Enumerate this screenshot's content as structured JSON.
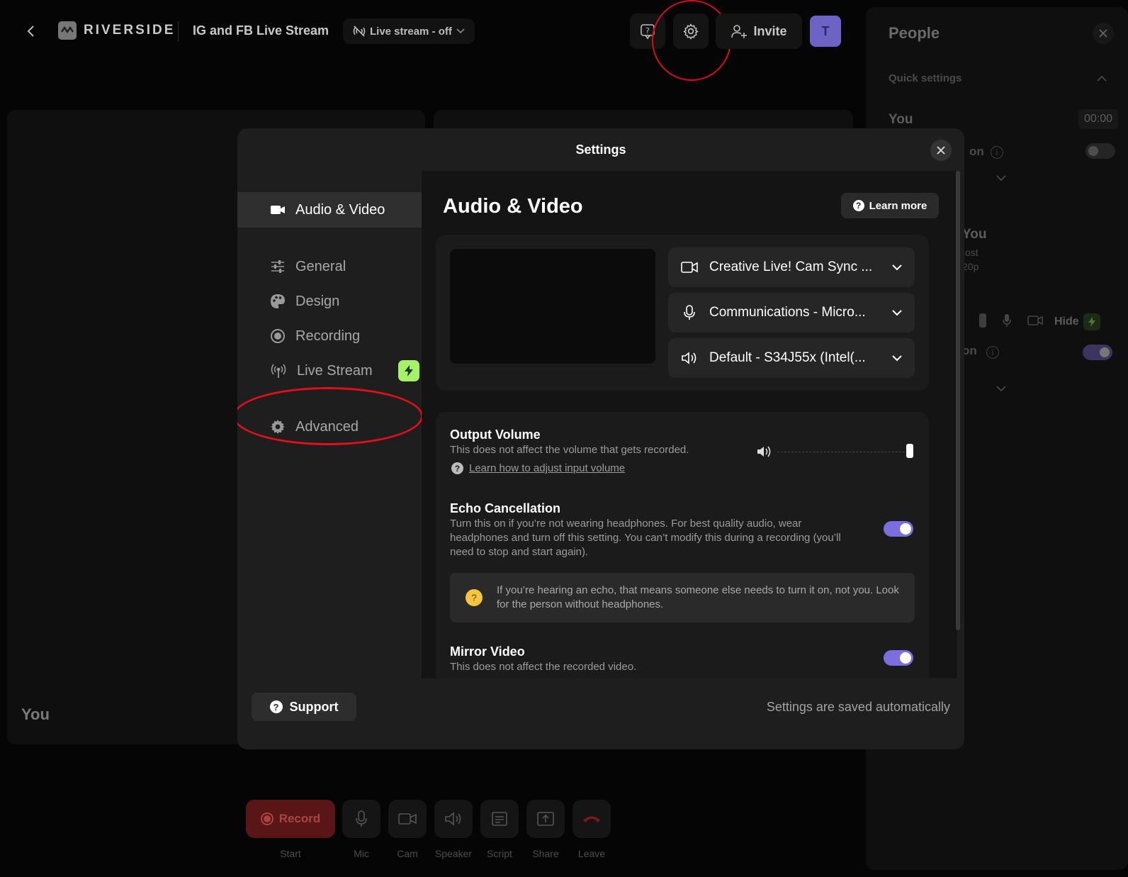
{
  "topbar": {
    "brand": "RIVERSIDE",
    "studio_title": "IG and FB Live Stream",
    "live_stream_status": "Live stream - off",
    "invite_label": "Invite",
    "avatar_initial": "T"
  },
  "stage": {
    "you_label": "You"
  },
  "people_panel": {
    "title": "People",
    "quick_settings": "Quick settings",
    "you_label": "You",
    "timer": "00:00",
    "partial_on_1": "on",
    "partial_you": "You",
    "partial_host": "ost",
    "partial_res": "20p",
    "hide_label": "Hide",
    "partial_on_2": "on"
  },
  "controls": {
    "record_label": "Record",
    "labels": [
      "Start",
      "Mic",
      "Cam",
      "Speaker",
      "Script",
      "Share",
      "Leave"
    ]
  },
  "modal": {
    "title": "Settings",
    "nav": [
      {
        "label": "Audio & Video",
        "icon": "video-camera-icon"
      },
      {
        "label": "General",
        "icon": "sliders-icon"
      },
      {
        "label": "Design",
        "icon": "palette-icon"
      },
      {
        "label": "Recording",
        "icon": "record-icon"
      },
      {
        "label": "Live Stream",
        "icon": "broadcast-icon"
      },
      {
        "label": "Advanced",
        "icon": "gear-icon"
      }
    ],
    "content_title": "Audio & Video",
    "learn_more": "Learn more",
    "devices": {
      "camera": "Creative Live! Cam Sync ...",
      "microphone": "Communications - Micro...",
      "speaker": "Default - S34J55x (Intel(..."
    },
    "output_volume": {
      "title": "Output Volume",
      "desc": "This does not affect the volume that gets recorded.",
      "link": "Learn how to adjust input volume",
      "level": 1.0
    },
    "echo": {
      "title": "Echo Cancellation",
      "desc": "Turn this on if you’re not wearing headphones. For best quality audio, wear headphones and turn off this setting. You can’t modify this during a recording (you’ll need to stop and start again).",
      "enabled": true,
      "tip": "If you’re hearing an echo, that means someone else needs to turn it on, not you. Look for the person without headphones."
    },
    "mirror": {
      "title": "Mirror Video",
      "desc": "This does not affect the recorded video.",
      "enabled": true
    },
    "support": "Support",
    "saved_note": "Settings are saved automatically"
  }
}
